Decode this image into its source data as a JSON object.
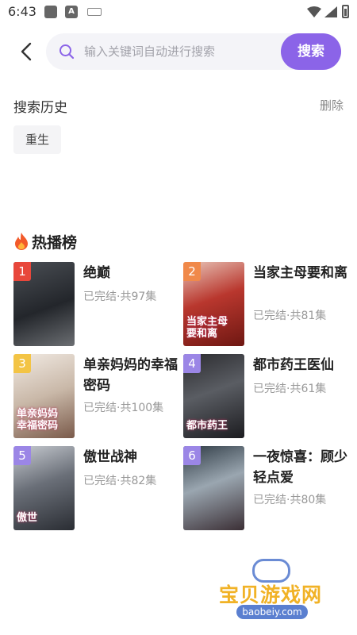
{
  "status_bar": {
    "time": "6:43"
  },
  "search": {
    "placeholder": "输入关键词自动进行搜索",
    "value": "",
    "button_label": "搜索"
  },
  "history": {
    "title": "搜索历史",
    "delete_label": "删除",
    "items": [
      "重生"
    ]
  },
  "hot": {
    "title": "热播榜",
    "items": [
      {
        "rank": "1",
        "title": "绝巅",
        "meta": "已完结·共97集",
        "rank_color": "#e8473b",
        "poster_text": "",
        "poster_bg": "linear-gradient(160deg,#4b4f55 0%,#23262b 55%,#6b6e72 100%)"
      },
      {
        "rank": "2",
        "title": "当家主母要和离",
        "meta": "已完结·共81集",
        "rank_color": "#f0894a",
        "poster_text": "当家主母\n要和离",
        "poster_bg": "linear-gradient(160deg,#e8c5b8 0%,#b9372e 45%,#6e1712 100%)"
      },
      {
        "rank": "3",
        "title": "单亲妈妈的幸福密码",
        "meta": "已完结·共100集",
        "rank_color": "#f3c445",
        "poster_text": "单亲妈妈\n幸福密码",
        "poster_bg": "linear-gradient(160deg,#f1eae3 0%,#c9b8a8 50%,#7a5a4a 100%)"
      },
      {
        "rank": "4",
        "title": "都市药王医仙",
        "meta": "已完结·共61集",
        "rank_color": "#9b86e6",
        "poster_text": "都市药王",
        "poster_bg": "linear-gradient(160deg,#2b2b2f 0%,#5a5d63 45%,#1c1c20 100%)"
      },
      {
        "rank": "5",
        "title": "傲世战神",
        "meta": "已完结·共82集",
        "rank_color": "#9b86e6",
        "poster_text": "傲世",
        "poster_bg": "linear-gradient(160deg,#c8ccd2 0%,#6a6f78 45%,#2a2d33 100%)"
      },
      {
        "rank": "6",
        "title": "一夜惊喜：顾少轻点爱",
        "meta": "已完结·共80集",
        "rank_color": "#9b86e6",
        "poster_text": "",
        "poster_bg": "linear-gradient(160deg,#2e3a44 0%,#9aa6b0 45%,#3b2f35 100%)"
      }
    ]
  },
  "watermark": {
    "brand": "宝贝游戏网",
    "url": "baobeiy.com"
  },
  "colors": {
    "accent": "#8b64e8"
  }
}
